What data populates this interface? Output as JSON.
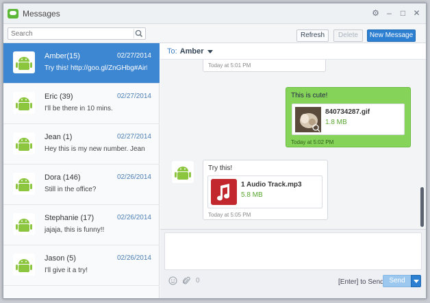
{
  "window": {
    "title": "Messages"
  },
  "toolbar": {
    "search_placeholder": "Search",
    "refresh_label": "Refresh",
    "delete_label": "Delete",
    "new_message_label": "New Message"
  },
  "contacts": [
    {
      "name": "Amber(15)",
      "date": "02/27/2014",
      "preview": "Try this! http://goo.gl/ZnGHbg#AirDr...",
      "active": true
    },
    {
      "name": "Eric (39)",
      "date": "02/27/2014",
      "preview": "I'll be there in 10 mins."
    },
    {
      "name": "Jean (1)",
      "date": "02/27/2014",
      "preview": "Hey this is my new number. Jean"
    },
    {
      "name": "Dora (146)",
      "date": "02/26/2014",
      "preview": "Still in the office?"
    },
    {
      "name": "Stephanie (17)",
      "date": "02/26/2014",
      "preview": "jajaja, this is funny!!"
    },
    {
      "name": "Jason (5)",
      "date": "02/26/2014",
      "preview": "I'll give it a try!"
    }
  ],
  "conversation": {
    "to_label": "To:",
    "to_name": "Amber",
    "messages": [
      {
        "direction": "in",
        "timestamp": "Today at 5:01 PM"
      },
      {
        "direction": "out",
        "text": "This is cute!",
        "file_name": "840734287.gif",
        "file_size": "1.8 MB",
        "timestamp": "Today at 5:02 PM"
      },
      {
        "direction": "in",
        "text": "Try this!",
        "file_name": "1 Audio Track.mp3",
        "file_size": "5.8 MB",
        "timestamp": "Today at 5:05 PM"
      }
    ]
  },
  "composer": {
    "hint": "[Enter] to Send",
    "send_label": "Send",
    "attachment_count": "0"
  },
  "colors": {
    "accent": "#2d7fd2",
    "selected_row": "#3d86d1",
    "outgoing_bubble": "#86d35a",
    "android_green": "#8cc63f"
  }
}
